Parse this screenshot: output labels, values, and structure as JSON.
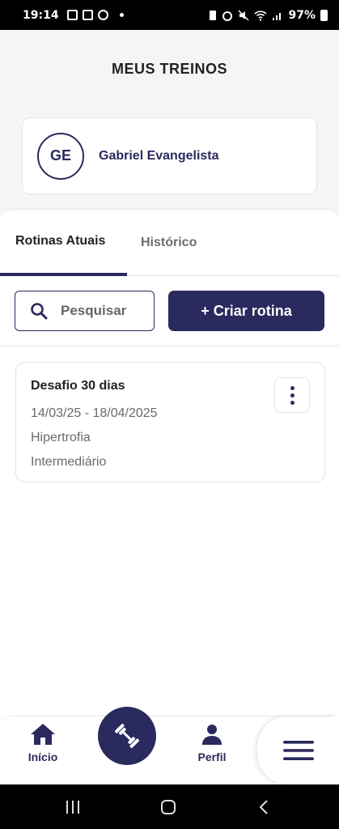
{
  "status_bar": {
    "time": "19:14",
    "battery": "97%"
  },
  "page": {
    "title": "MEUS TREINOS"
  },
  "profile": {
    "initials": "GE",
    "name": "Gabriel Evangelista"
  },
  "tabs": [
    {
      "label": "Rotinas Atuais",
      "active": true
    },
    {
      "label": "Histórico",
      "active": false
    }
  ],
  "search": {
    "placeholder": "Pesquisar",
    "icon": "search-icon"
  },
  "create_button": {
    "label": "+ Criar rotina"
  },
  "routines": [
    {
      "title": "Desafio 30 dias",
      "dates": "14/03/25 - 18/04/2025",
      "goal": "Hipertrofia",
      "level": "Intermediário",
      "menu_icon": "more-vertical-icon"
    }
  ],
  "bottom_nav": {
    "home_label": "Início",
    "profile_label": "Perfil",
    "home_icon": "home-icon",
    "workout_icon": "dumbbell-icon",
    "profile_icon": "user-icon",
    "menu_icon": "hamburger-menu-icon"
  },
  "colors": {
    "primary": "#2b2a5e",
    "background": "#f5f5f5",
    "card": "#ffffff",
    "muted_text": "#6a6a6a"
  }
}
